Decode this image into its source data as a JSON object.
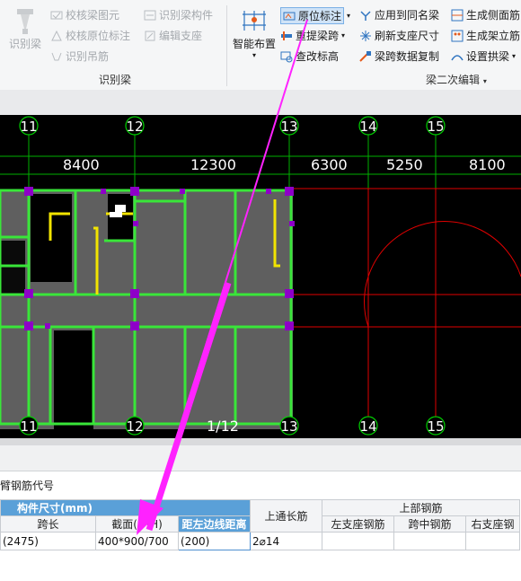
{
  "ribbon": {
    "identify_group": {
      "label": "识别梁",
      "big_button": "识别梁",
      "items": [
        "校核梁图元",
        "识别梁构件",
        "校核原位标注",
        "编辑支座",
        "识别吊筋"
      ]
    },
    "smart_layout": "智能布置",
    "secondary_edit_group": {
      "label": "梁二次编辑",
      "col1": [
        "原位标注",
        "重提梁跨",
        "查改标高"
      ],
      "col2": [
        "应用到同名梁",
        "刷新支座尺寸",
        "梁跨数据复制"
      ],
      "col3": [
        "生成侧面筋",
        "生成架立筋",
        "设置拱梁"
      ]
    }
  },
  "cad": {
    "axes_top": [
      "11",
      "12",
      "13",
      "14",
      "15"
    ],
    "axes_bottom": [
      "11",
      "12",
      "13",
      "14",
      "15"
    ],
    "dimensions": [
      "8400",
      "12300",
      "6300",
      "5250",
      "8100"
    ],
    "scale_label": "1/12"
  },
  "panel": {
    "row_label": "臂钢筋代号",
    "group_size": "构件尺寸(mm)",
    "top_rebar_group": "上部钢筋",
    "headers": {
      "span_length": "跨长",
      "section": "截面(B*H)",
      "dist_left_edge": "距左边线距离",
      "top_through_bar": "上通长筋",
      "left_support": "左支座钢筋",
      "mid_span": "跨中钢筋",
      "right_support": "右支座钢"
    },
    "row": {
      "span_length": "(2475)",
      "section": "400*900/700",
      "dist_left_edge": "(200)",
      "top_through_bar": "2⌀14",
      "left_support": "",
      "mid_span": "",
      "right_support": ""
    }
  },
  "colors": {
    "wall_green": "#39e639",
    "column_purple": "#8e00c8",
    "slab_gray": "#5f5f5f",
    "axis_green": "#00d000",
    "red_lines": "#e00000",
    "arrow_magenta": "#ff22ff",
    "header_blue": "#5aa0d8"
  }
}
